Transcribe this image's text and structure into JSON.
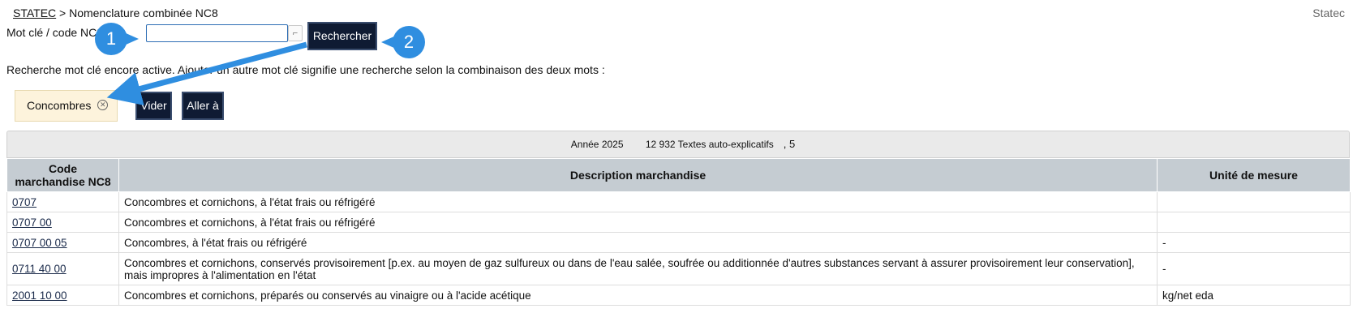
{
  "header": {
    "breadcrumb_root": "STATEC",
    "breadcrumb_separator": ">",
    "breadcrumb_current": "Nomenclature combinée NC8",
    "site_name": "Statec"
  },
  "search": {
    "label": "Mot clé / code NC8",
    "value": "",
    "button_label": "Rechercher"
  },
  "notice": "Recherche mot clé encore active. Ajouter un autre mot clé signifie une recherche selon la combinaison des deux mots :",
  "active_keyword": {
    "label": "Concombres",
    "remove_icon": "circle-x-icon"
  },
  "actions": {
    "clear_label": "Vider",
    "goto_label": "Aller à"
  },
  "stats": {
    "year": "Année 2025",
    "texts": "12 932 Textes auto-explicatifs",
    "results_suffix": ", 5"
  },
  "table": {
    "headers": [
      "Code marchandise NC8",
      "Description marchandise",
      "Unité de mesure"
    ],
    "rows": [
      {
        "code": "0707",
        "description": "Concombres et cornichons, à l'état frais ou réfrigéré",
        "unit": ""
      },
      {
        "code": "0707 00",
        "description": "Concombres et cornichons, à l'état frais ou réfrigéré",
        "unit": ""
      },
      {
        "code": "0707 00 05",
        "description": "Concombres, à l'état frais ou réfrigéré",
        "unit": "-"
      },
      {
        "code": "0711 40 00",
        "description": "Concombres et cornichons, conservés provisoirement [p.ex. au moyen de gaz sulfureux ou dans de l'eau salée, soufrée ou additionnée d'autres substances servant à assurer provisoirement leur conservation], mais impropres à l'alimentation en l'état",
        "unit": "-"
      },
      {
        "code": "2001 10 00",
        "description": "Concombres et cornichons, préparés ou conservés au vinaigre ou à l'acide acétique",
        "unit": "kg/net eda"
      }
    ]
  },
  "annotations": {
    "callout_1": "1",
    "callout_2": "2",
    "accent_color": "#2f8ee0"
  },
  "colors": {
    "button_bg": "#0f1b33",
    "chip_bg": "#fdf3dc",
    "table_header_bg": "#c5ccd2"
  }
}
